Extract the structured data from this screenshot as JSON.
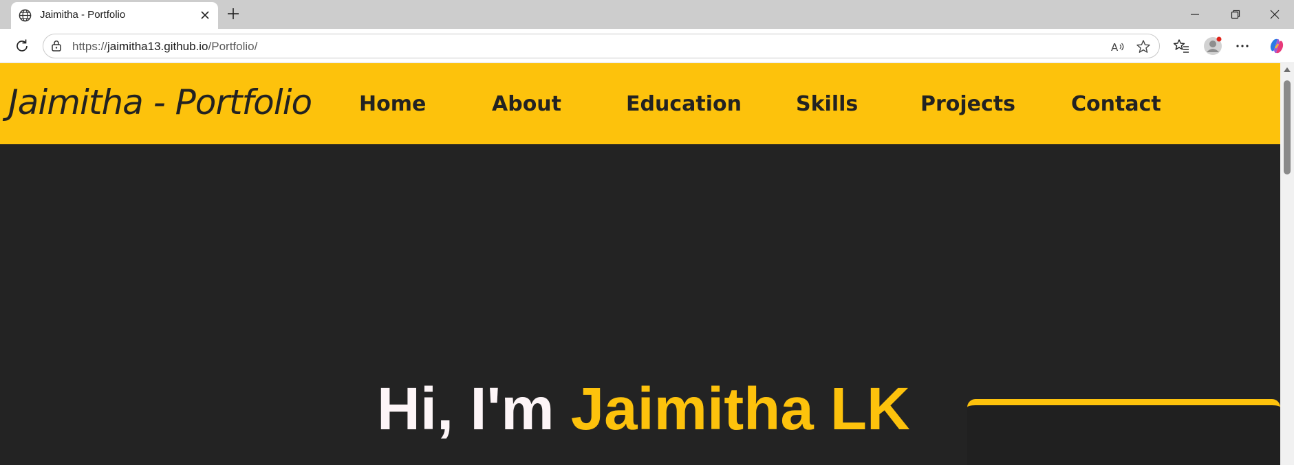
{
  "browser": {
    "tab": {
      "title": "Jaimitha - Portfolio",
      "favicon": "globe-icon",
      "close_icon": "close-icon"
    },
    "new_tab_icon": "plus-icon",
    "window_controls": [
      "minimize-icon",
      "restore-icon",
      "close-icon"
    ],
    "toolbar": {
      "refresh_icon": "refresh-icon",
      "url_prefix": "https://",
      "url_domain": "jaimitha13.github.io",
      "url_path": "/Portfolio/",
      "omnibox_icons": [
        "read-aloud-icon",
        "favorite-star-icon"
      ],
      "right_icons": [
        "favorites-icon",
        "profile-avatar",
        "more-menu-icon",
        "copilot-icon"
      ]
    }
  },
  "page": {
    "brand": "Jaimitha - Portfolio",
    "nav": [
      {
        "label": "Home"
      },
      {
        "label": "About"
      },
      {
        "label": "Education"
      },
      {
        "label": "Skills"
      },
      {
        "label": "Projects"
      },
      {
        "label": "Contact"
      }
    ],
    "hero": {
      "greeting": "Hi, I'm ",
      "name": "Jaimitha LK"
    }
  },
  "colors": {
    "accent": "#fdc20c",
    "background": "#232323",
    "text_dark": "#222222",
    "hero_white": "#fdf5f7"
  }
}
